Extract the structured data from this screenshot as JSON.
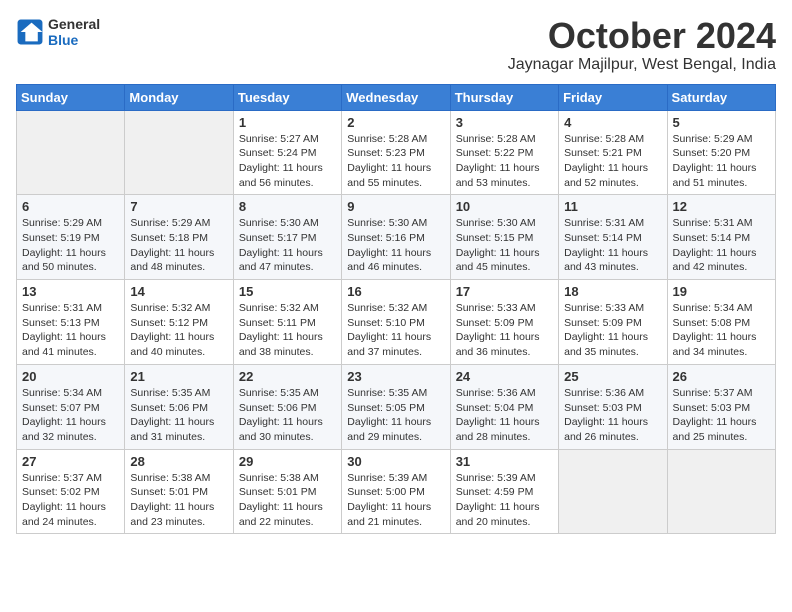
{
  "header": {
    "logo_general": "General",
    "logo_blue": "Blue",
    "month_title": "October 2024",
    "location": "Jaynagar Majilpur, West Bengal, India"
  },
  "days_of_week": [
    "Sunday",
    "Monday",
    "Tuesday",
    "Wednesday",
    "Thursday",
    "Friday",
    "Saturday"
  ],
  "weeks": [
    [
      {
        "day": "",
        "content": ""
      },
      {
        "day": "",
        "content": ""
      },
      {
        "day": "1",
        "content": "Sunrise: 5:27 AM\nSunset: 5:24 PM\nDaylight: 11 hours and 56 minutes."
      },
      {
        "day": "2",
        "content": "Sunrise: 5:28 AM\nSunset: 5:23 PM\nDaylight: 11 hours and 55 minutes."
      },
      {
        "day": "3",
        "content": "Sunrise: 5:28 AM\nSunset: 5:22 PM\nDaylight: 11 hours and 53 minutes."
      },
      {
        "day": "4",
        "content": "Sunrise: 5:28 AM\nSunset: 5:21 PM\nDaylight: 11 hours and 52 minutes."
      },
      {
        "day": "5",
        "content": "Sunrise: 5:29 AM\nSunset: 5:20 PM\nDaylight: 11 hours and 51 minutes."
      }
    ],
    [
      {
        "day": "6",
        "content": "Sunrise: 5:29 AM\nSunset: 5:19 PM\nDaylight: 11 hours and 50 minutes."
      },
      {
        "day": "7",
        "content": "Sunrise: 5:29 AM\nSunset: 5:18 PM\nDaylight: 11 hours and 48 minutes."
      },
      {
        "day": "8",
        "content": "Sunrise: 5:30 AM\nSunset: 5:17 PM\nDaylight: 11 hours and 47 minutes."
      },
      {
        "day": "9",
        "content": "Sunrise: 5:30 AM\nSunset: 5:16 PM\nDaylight: 11 hours and 46 minutes."
      },
      {
        "day": "10",
        "content": "Sunrise: 5:30 AM\nSunset: 5:15 PM\nDaylight: 11 hours and 45 minutes."
      },
      {
        "day": "11",
        "content": "Sunrise: 5:31 AM\nSunset: 5:14 PM\nDaylight: 11 hours and 43 minutes."
      },
      {
        "day": "12",
        "content": "Sunrise: 5:31 AM\nSunset: 5:14 PM\nDaylight: 11 hours and 42 minutes."
      }
    ],
    [
      {
        "day": "13",
        "content": "Sunrise: 5:31 AM\nSunset: 5:13 PM\nDaylight: 11 hours and 41 minutes."
      },
      {
        "day": "14",
        "content": "Sunrise: 5:32 AM\nSunset: 5:12 PM\nDaylight: 11 hours and 40 minutes."
      },
      {
        "day": "15",
        "content": "Sunrise: 5:32 AM\nSunset: 5:11 PM\nDaylight: 11 hours and 38 minutes."
      },
      {
        "day": "16",
        "content": "Sunrise: 5:32 AM\nSunset: 5:10 PM\nDaylight: 11 hours and 37 minutes."
      },
      {
        "day": "17",
        "content": "Sunrise: 5:33 AM\nSunset: 5:09 PM\nDaylight: 11 hours and 36 minutes."
      },
      {
        "day": "18",
        "content": "Sunrise: 5:33 AM\nSunset: 5:09 PM\nDaylight: 11 hours and 35 minutes."
      },
      {
        "day": "19",
        "content": "Sunrise: 5:34 AM\nSunset: 5:08 PM\nDaylight: 11 hours and 34 minutes."
      }
    ],
    [
      {
        "day": "20",
        "content": "Sunrise: 5:34 AM\nSunset: 5:07 PM\nDaylight: 11 hours and 32 minutes."
      },
      {
        "day": "21",
        "content": "Sunrise: 5:35 AM\nSunset: 5:06 PM\nDaylight: 11 hours and 31 minutes."
      },
      {
        "day": "22",
        "content": "Sunrise: 5:35 AM\nSunset: 5:06 PM\nDaylight: 11 hours and 30 minutes."
      },
      {
        "day": "23",
        "content": "Sunrise: 5:35 AM\nSunset: 5:05 PM\nDaylight: 11 hours and 29 minutes."
      },
      {
        "day": "24",
        "content": "Sunrise: 5:36 AM\nSunset: 5:04 PM\nDaylight: 11 hours and 28 minutes."
      },
      {
        "day": "25",
        "content": "Sunrise: 5:36 AM\nSunset: 5:03 PM\nDaylight: 11 hours and 26 minutes."
      },
      {
        "day": "26",
        "content": "Sunrise: 5:37 AM\nSunset: 5:03 PM\nDaylight: 11 hours and 25 minutes."
      }
    ],
    [
      {
        "day": "27",
        "content": "Sunrise: 5:37 AM\nSunset: 5:02 PM\nDaylight: 11 hours and 24 minutes."
      },
      {
        "day": "28",
        "content": "Sunrise: 5:38 AM\nSunset: 5:01 PM\nDaylight: 11 hours and 23 minutes."
      },
      {
        "day": "29",
        "content": "Sunrise: 5:38 AM\nSunset: 5:01 PM\nDaylight: 11 hours and 22 minutes."
      },
      {
        "day": "30",
        "content": "Sunrise: 5:39 AM\nSunset: 5:00 PM\nDaylight: 11 hours and 21 minutes."
      },
      {
        "day": "31",
        "content": "Sunrise: 5:39 AM\nSunset: 4:59 PM\nDaylight: 11 hours and 20 minutes."
      },
      {
        "day": "",
        "content": ""
      },
      {
        "day": "",
        "content": ""
      }
    ]
  ]
}
